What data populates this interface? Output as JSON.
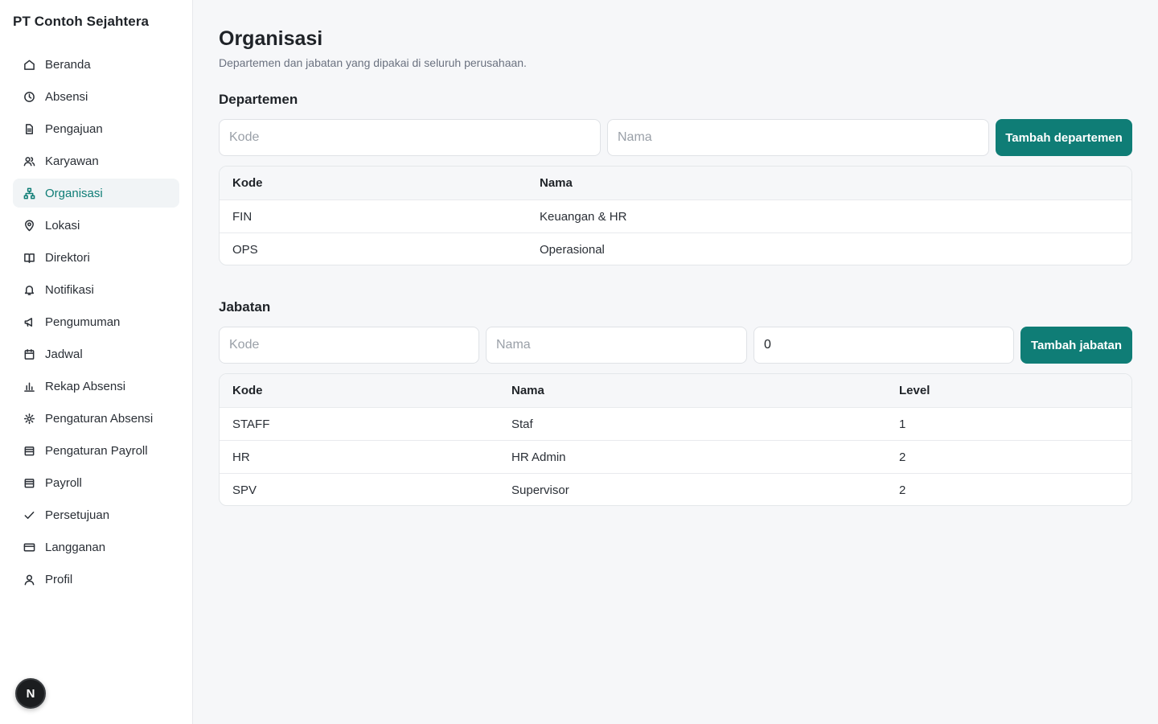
{
  "sidebar": {
    "brand": "PT Contoh Sejahtera",
    "items": [
      {
        "label": "Beranda",
        "icon": "home-icon"
      },
      {
        "label": "Absensi",
        "icon": "clock-icon"
      },
      {
        "label": "Pengajuan",
        "icon": "file-icon"
      },
      {
        "label": "Karyawan",
        "icon": "users-icon"
      },
      {
        "label": "Organisasi",
        "icon": "org-chart-icon",
        "active": true
      },
      {
        "label": "Lokasi",
        "icon": "map-pin-icon"
      },
      {
        "label": "Direktori",
        "icon": "book-icon"
      },
      {
        "label": "Notifikasi",
        "icon": "bell-icon"
      },
      {
        "label": "Pengumuman",
        "icon": "megaphone-icon"
      },
      {
        "label": "Jadwal",
        "icon": "calendar-icon"
      },
      {
        "label": "Rekap Absensi",
        "icon": "bar-chart-icon"
      },
      {
        "label": "Pengaturan Absensi",
        "icon": "gear-icon"
      },
      {
        "label": "Pengaturan Payroll",
        "icon": "wallet-icon"
      },
      {
        "label": "Payroll",
        "icon": "wallet-icon"
      },
      {
        "label": "Persetujuan",
        "icon": "check-icon"
      },
      {
        "label": "Langganan",
        "icon": "credit-card-icon"
      },
      {
        "label": "Profil",
        "icon": "user-icon"
      }
    ],
    "avatar_letter": "N"
  },
  "header": {
    "title": "Organisasi",
    "subtitle": "Departemen dan jabatan yang dipakai di seluruh perusahaan."
  },
  "departemen": {
    "title": "Departemen",
    "kode_placeholder": "Kode",
    "nama_placeholder": "Nama",
    "add_label": "Tambah departemen",
    "columns": [
      "Kode",
      "Nama"
    ],
    "rows": [
      [
        "FIN",
        "Keuangan & HR"
      ],
      [
        "OPS",
        "Operasional"
      ]
    ]
  },
  "jabatan": {
    "title": "Jabatan",
    "kode_placeholder": "Kode",
    "nama_placeholder": "Nama",
    "level_value": "0",
    "add_label": "Tambah jabatan",
    "columns": [
      "Kode",
      "Nama",
      "Level"
    ],
    "rows": [
      [
        "STAFF",
        "Staf",
        "1"
      ],
      [
        "HR",
        "HR Admin",
        "2"
      ],
      [
        "SPV",
        "Supervisor",
        "2"
      ]
    ]
  },
  "colors": {
    "accent": "#0f7d76",
    "active_bg": "#f1f4f6",
    "page_bg": "#f6f7f9"
  }
}
